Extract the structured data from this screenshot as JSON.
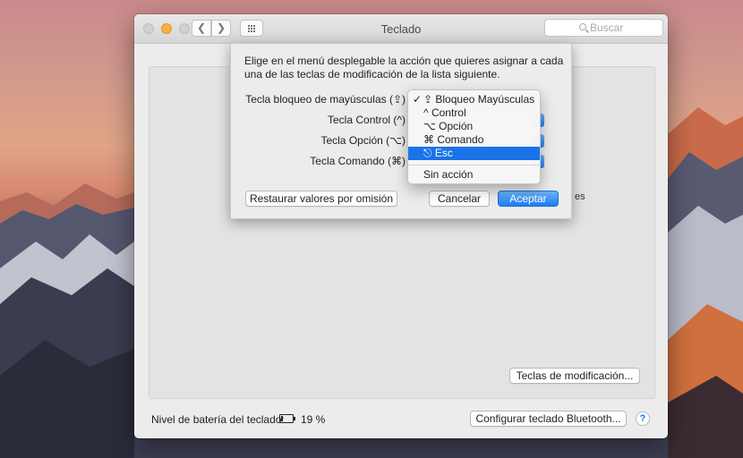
{
  "window": {
    "title": "Teclado",
    "search_placeholder": "Buscar",
    "nav_back": "❮",
    "nav_forward": "❯"
  },
  "footer": {
    "battery_label": "Nivel de batería del teclado:",
    "battery_percent": "19 %",
    "bluetooth_button": "Configurar teclado Bluetooth...",
    "help": "?"
  },
  "panel": {
    "modifier_keys_button": "Teclas de modificación...",
    "partial_text": "es"
  },
  "sheet": {
    "instructions": "Elige en el menú desplegable la acción que quieres asignar a cada una de las teclas de modificación de la lista siguiente.",
    "rows": [
      {
        "label": "Tecla bloqueo de mayúsculas (⇪)"
      },
      {
        "label": "Tecla Control (^)"
      },
      {
        "label": "Tecla Opción (⌥)"
      },
      {
        "label": "Tecla Comando (⌘)"
      }
    ],
    "restore_button": "Restaurar valores por omisión",
    "cancel_button": "Cancelar",
    "accept_button": "Aceptar"
  },
  "menu": {
    "checkmark": "✓",
    "items": [
      {
        "label": "⇪ Bloqueo Mayúsculas",
        "checked": true
      },
      {
        "label": "^ Control"
      },
      {
        "label": "⌥ Opción"
      },
      {
        "label": "⌘ Comando"
      },
      {
        "label": "⎋ Esc",
        "selected": true
      }
    ],
    "no_action": "Sin acción"
  }
}
